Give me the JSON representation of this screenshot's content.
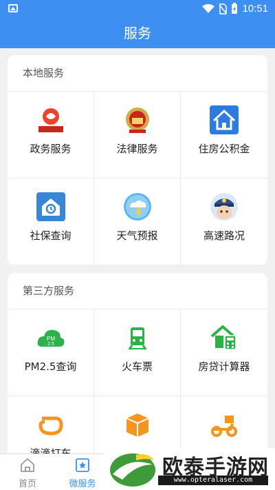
{
  "status_bar": {
    "time": "10:51"
  },
  "header": {
    "title": "服务"
  },
  "local_section": {
    "title": "本地服务",
    "items": [
      {
        "label": "政务服务",
        "icon": "government-emblem-icon"
      },
      {
        "label": "法律服务",
        "icon": "court-emblem-icon"
      },
      {
        "label": "住房公积金",
        "icon": "house-icon"
      },
      {
        "label": "社保查询",
        "icon": "social-security-icon"
      },
      {
        "label": "天气预报",
        "icon": "weather-icon"
      },
      {
        "label": "高速路况",
        "icon": "police-officer-icon"
      }
    ]
  },
  "third_party_section": {
    "title": "第三方服务",
    "items": [
      {
        "label": "PM2.5查询",
        "icon": "pm25-cloud-icon"
      },
      {
        "label": "火车票",
        "icon": "train-icon"
      },
      {
        "label": "房贷计算器",
        "icon": "house-calculator-icon"
      },
      {
        "label": "滴滴打车",
        "icon": "didi-icon"
      },
      {
        "label": "",
        "icon": "package-box-icon"
      },
      {
        "label": "",
        "icon": "delivery-scooter-icon"
      }
    ]
  },
  "tabbar": {
    "tabs": [
      {
        "label": "首页",
        "active": false
      },
      {
        "label": "微服务",
        "active": true
      }
    ]
  },
  "watermark": {
    "title": "欧泰手游网",
    "url": "www.opteralaser.com"
  },
  "colors": {
    "primary": "#3d8ff2",
    "green": "#2db24a",
    "orange": "#f5941e"
  }
}
